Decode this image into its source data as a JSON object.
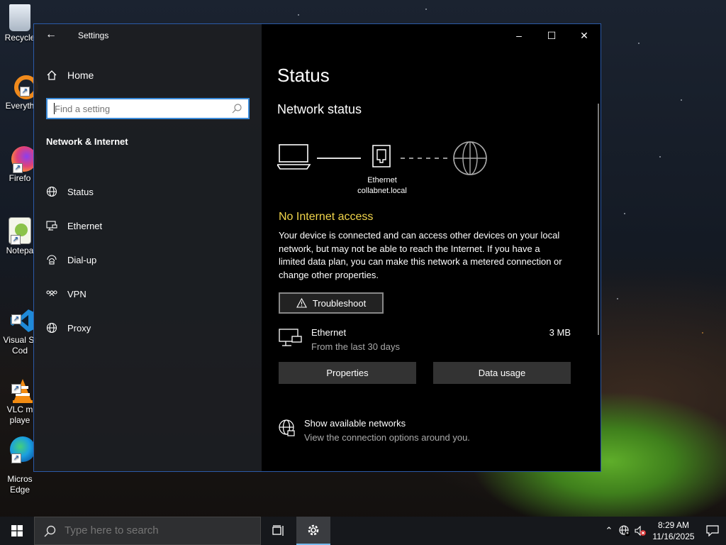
{
  "desktop": {
    "icons": [
      {
        "label": "Recycle",
        "icon": "recycle-bin-icon"
      },
      {
        "label": "Everyth",
        "icon": "everything-icon"
      },
      {
        "label": "Firefo",
        "icon": "firefox-icon"
      },
      {
        "label": "Notepa",
        "icon": "notepad-icon"
      },
      {
        "label": "Visual St\nCod",
        "icon": "vscode-icon"
      },
      {
        "label": "VLC m\nplaye",
        "icon": "vlc-icon"
      },
      {
        "label": "Micros\nEdge",
        "icon": "edge-icon"
      }
    ]
  },
  "window": {
    "title": "Settings",
    "controls": {
      "minimize": "–",
      "maximize": "☐",
      "close": "✕"
    }
  },
  "sidebar": {
    "home_label": "Home",
    "search_placeholder": "Find a setting",
    "section_title": "Network & Internet",
    "items": [
      {
        "label": "Status",
        "icon": "globe-icon"
      },
      {
        "label": "Ethernet",
        "icon": "ethernet-icon"
      },
      {
        "label": "Dial-up",
        "icon": "dialup-icon"
      },
      {
        "label": "VPN",
        "icon": "vpn-icon"
      },
      {
        "label": "Proxy",
        "icon": "globe-icon"
      }
    ]
  },
  "main": {
    "title": "Status",
    "network_status_heading": "Network status",
    "diagram": {
      "adapter_name": "Ethernet",
      "network_name": "collabnet.local"
    },
    "alert": "No Internet access",
    "description": "Your device is connected and can access other devices on your local network, but may not be able to reach the Internet. If you have a limited data plan, you can make this network a metered connection or change other properties.",
    "troubleshoot_label": "Troubleshoot",
    "connection": {
      "name": "Ethernet",
      "subtitle": "From the last 30 days",
      "usage": "3 MB"
    },
    "properties_label": "Properties",
    "data_usage_label": "Data usage",
    "show_networks": {
      "title": "Show available networks",
      "subtitle": "View the connection options around you."
    }
  },
  "taskbar": {
    "search_placeholder": "Type here to search",
    "time": "8:29 AM",
    "date": "11/16/2025"
  },
  "colors": {
    "accent": "#3b8bd9",
    "alert": "#f1d54b"
  }
}
